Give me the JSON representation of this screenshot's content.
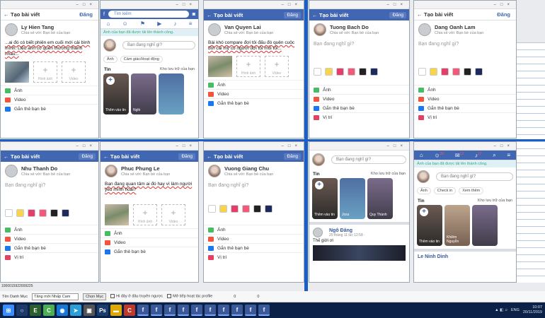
{
  "composer": {
    "create_title": "Tạo bài viết",
    "post_label": "Đăng",
    "privacy": "Chia sẻ với: Bạn bè của bạn",
    "placeholder": "Bạn đang nghĩ gì?",
    "add_photo": "Hình ảnh",
    "add_video": "Video",
    "options": [
      "Ảnh",
      "Video",
      "Gắn thẻ bạn bè",
      "Vị trí"
    ]
  },
  "windows": {
    "w1": {
      "name": "Ly Hien Tang",
      "text": "...ai đó có biết phiên em cuối mới cải bình mình. Liệu anh có quên thương thành nhau..."
    },
    "w3": {
      "name": "Van Quyen Lai",
      "text": "Bài khó compare đợi tôi đấu đó quên cuộc đời cái mỹ có người đợi tôi mỗi tối..."
    },
    "w4": {
      "name": "Tuong Bach Do"
    },
    "w5": {
      "name": "Dang Oanh Lam"
    },
    "w6": {
      "name": "Nhu Thanh Do"
    },
    "w7": {
      "name": "Phuc Phung Le",
      "text": "Bạn đang quan tâm ai đó hay vì làm người yêu mình hoài?"
    },
    "w8": {
      "name": "Vuong Giang Chu"
    }
  },
  "feed": {
    "search": "Tìm kiếm",
    "notice": "Ảnh của bạn đã được tải lên thành công.",
    "composer_placeholder": "Bạn đang nghĩ gì?",
    "chips": [
      "Ảnh",
      "Cảm giác/Hoạt động",
      "Check in"
    ],
    "stories_title": "Tin",
    "stories_archive": "Kho lưu trữ của bạn",
    "add_story": "Thêm vào tin",
    "story_names": [
      "Nghi",
      "Joss",
      "Tường",
      "Quy Thành",
      "Khiêm Nguyễn"
    ],
    "check_in": "Check in",
    "view_more": "Xem thêm",
    "post_author": "Ngô Đăng",
    "post_meta": "20 tháng 11 lúc 12:58 · ",
    "post_text": "Thế giới ơi",
    "post_author2": "Le Ninh Dinh",
    "tab_badges": [
      "20",
      "12",
      "17",
      "24",
      "47"
    ]
  },
  "taskbar": {
    "list_label": "Tên Danh Mục",
    "combo_value": "Tăng mới Nhấp Cam",
    "select_btn": "Chọn Mục",
    "check1": "Hi đây ở đâu truyền ngược",
    "check2": "Mở tiếp hoạt tác profile",
    "count1": "0",
    "count2": "0",
    "row_id": "1000015922009225",
    "lang": "ENG",
    "time": "10:07",
    "date": "20/11/2019"
  }
}
